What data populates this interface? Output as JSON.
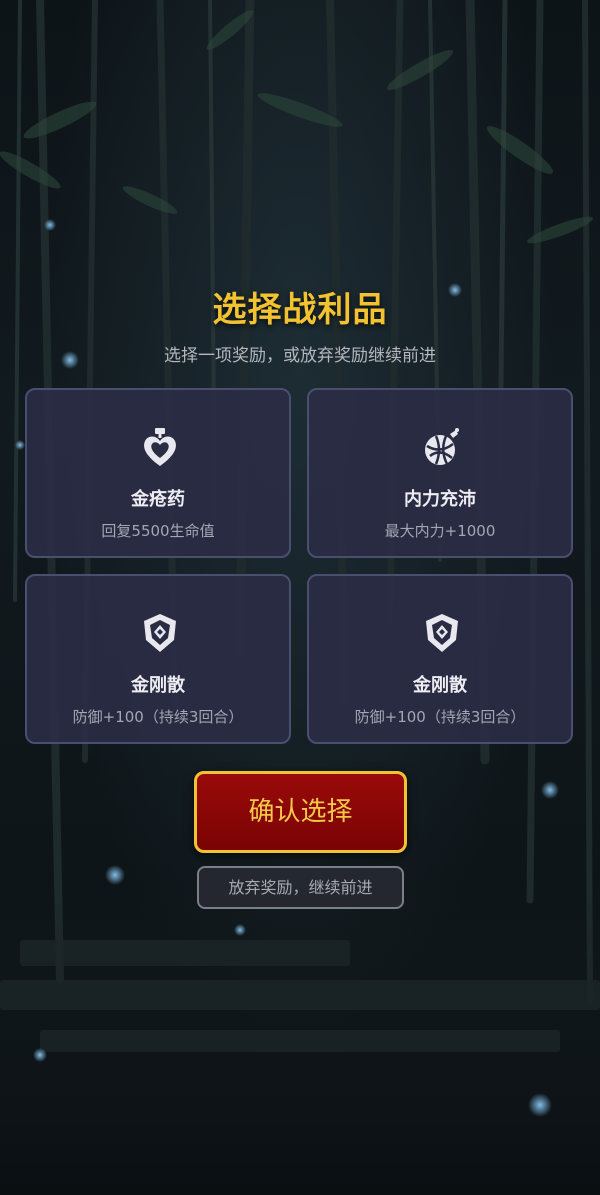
{
  "header": {
    "title": "选择战利品",
    "subtitle": "选择一项奖励，或放弃奖励继续前进"
  },
  "rewards": [
    {
      "name": "金疮药",
      "desc": "回复5500生命值",
      "icon": "heart-potion-icon"
    },
    {
      "name": "内力充沛",
      "desc": "最大内力+1000",
      "icon": "energy-orb-icon"
    },
    {
      "name": "金刚散",
      "desc": "防御+100（持续3回合）",
      "icon": "shield-icon"
    },
    {
      "name": "金刚散",
      "desc": "防御+100（持续3回合）",
      "icon": "shield-icon"
    }
  ],
  "actions": {
    "confirm_label": "确认选择",
    "abandon_label": "放弃奖励，继续前进"
  },
  "colors": {
    "title": "#f2c230",
    "confirm_bg": "#8b0606",
    "confirm_border": "#f1c232",
    "card_bg": "#2a2c44",
    "card_border": "#4a4f70"
  }
}
